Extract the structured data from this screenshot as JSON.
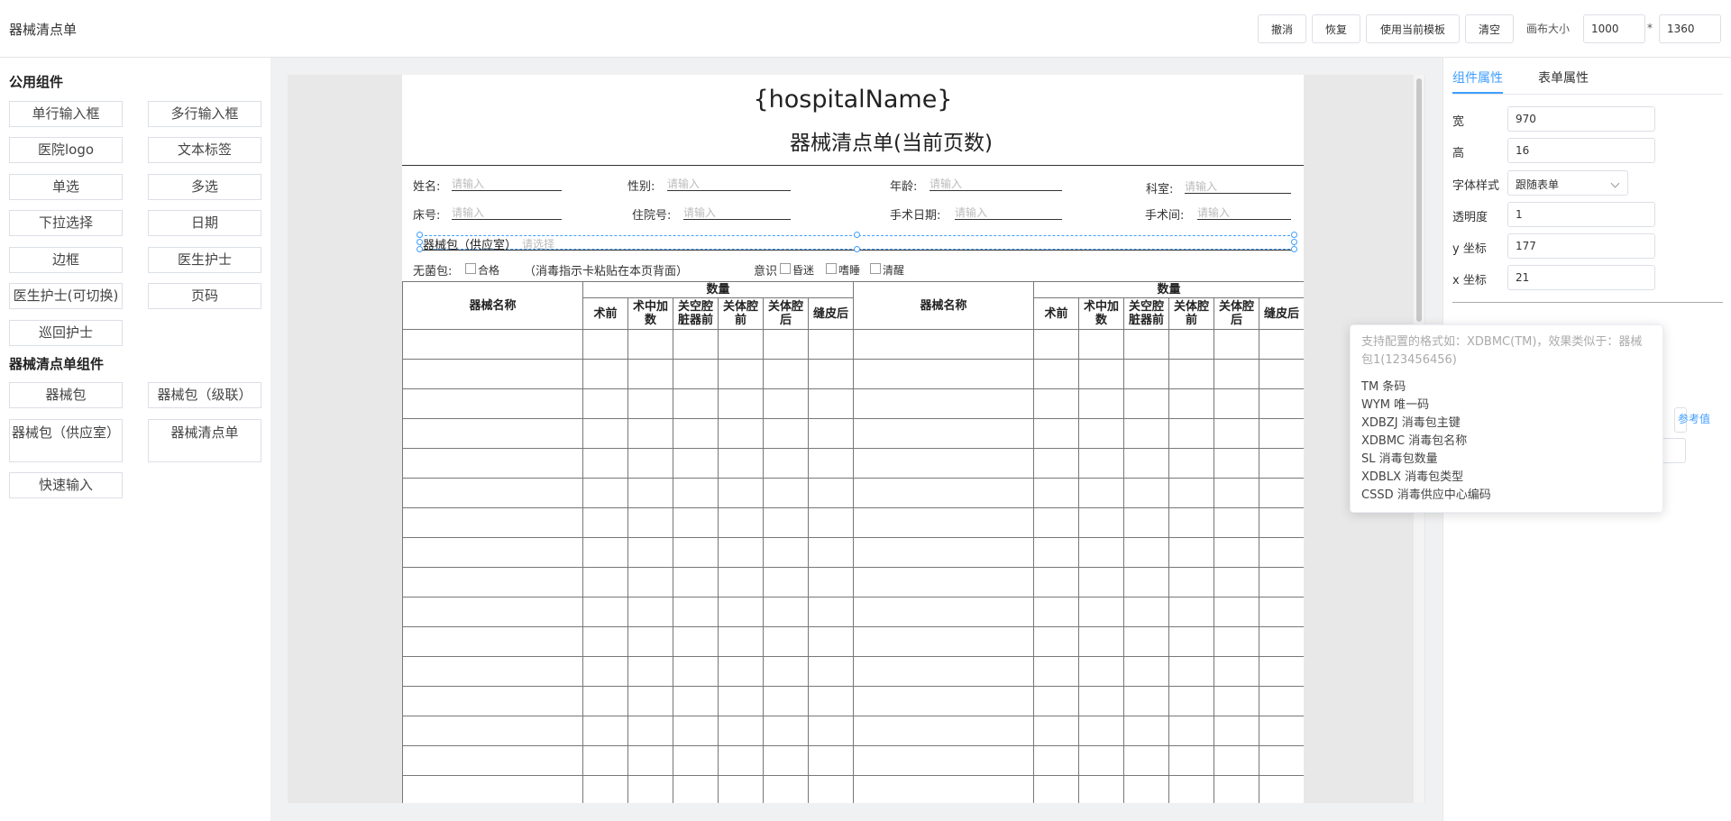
{
  "app": {
    "title": "器械清点单"
  },
  "toolbar": {
    "undo": "撤消",
    "redo": "恢复",
    "use_template": "使用当前模板",
    "clear": "清空",
    "canvas_size_label": "画布大小",
    "canvas_width": "1000",
    "times": "*",
    "canvas_height": "1360"
  },
  "left_panel": {
    "public_title": "公用组件",
    "public_items": [
      "单行输入框",
      "多行输入框",
      "医院logo",
      "文本标签",
      "单选",
      "多选",
      "下拉选择",
      "日期",
      "边框",
      "医生护士",
      "医生护士(可切换)",
      "页码",
      "巡回护士"
    ],
    "instrument_title": "器械清点单组件",
    "instrument_items": [
      "器械包",
      "器械包（级联）",
      "器械包（供应室）",
      "器械清点单",
      "快速输入"
    ]
  },
  "paper": {
    "hospital_name": "{hospitalName}",
    "title": "器械清点单(当前页数)",
    "fields": {
      "name_label": "姓名:",
      "gender_label": "性别:",
      "age_label": "年龄:",
      "dept_label": "科室:",
      "bed_label": "床号:",
      "inpatient_label": "住院号:",
      "surgery_date_label": "手术日期:",
      "surgery_room_label": "手术间:",
      "input_placeholder": "请输入"
    },
    "package": {
      "label": "器械包（供应室）",
      "placeholder": "请选择"
    },
    "sterile": {
      "label": "无菌包:",
      "qualified": "合格",
      "note": "（消毒指示卡粘贴在本页背面）",
      "consciousness": "意识",
      "coma": "昏迷",
      "drowsy": "嗜睡",
      "awake": "清醒"
    },
    "table": {
      "name_header": "器械名称",
      "qty_header": "数量",
      "sub_headers": [
        "术前",
        "术中加数",
        "关空腔脏器前",
        "关体腔前",
        "关体腔后",
        "缝皮后"
      ]
    }
  },
  "right_panel": {
    "tabs": [
      "组件属性",
      "表单属性"
    ],
    "props": {
      "width_label": "宽",
      "width": "970",
      "height_label": "高",
      "height": "16",
      "font_label": "字体样式",
      "font": "跟随表单",
      "opacity_label": "透明度",
      "opacity": "1",
      "y_label": "y 坐标",
      "y": "177",
      "x_label": "x 坐标",
      "x": "21"
    },
    "ref_link": "参考值"
  },
  "tooltip": {
    "hint": "支持配置的格式如：XDBMC(TM)，效果类似于：器械包1(123456456)",
    "items": [
      "TM 条码",
      "WYM 唯一码",
      "XDBZJ 消毒包主键",
      "XDBMC 消毒包名称",
      "SL 消毒包数量",
      "XDBLX 消毒包类型",
      "CSSD 消毒供应中心编码"
    ]
  }
}
